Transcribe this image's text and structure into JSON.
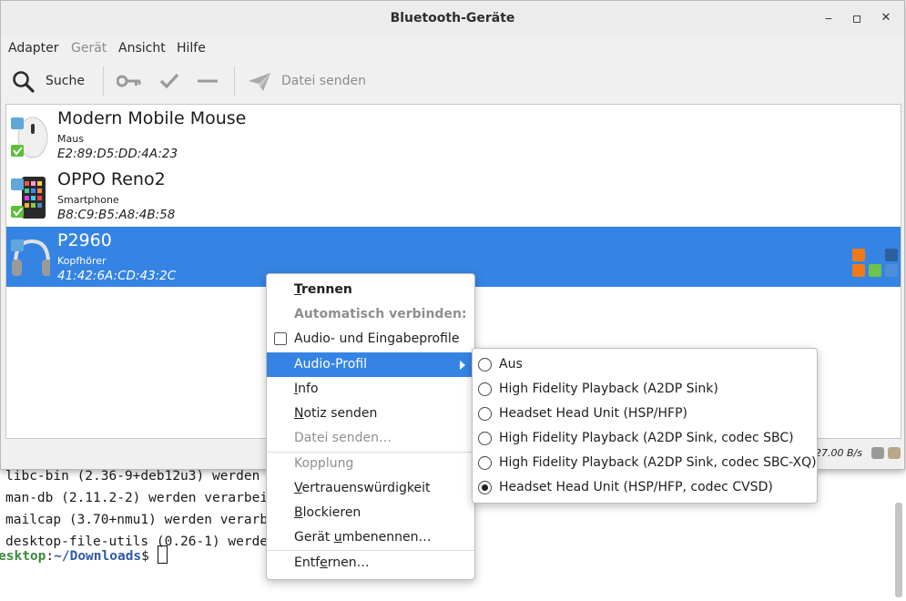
{
  "terminal": {
    "lines": [
      "libc-bin (2.36-9+deb12u3) werden verarbeitet ...",
      "man-db (2.11.2-2) werden verarbeitet ...",
      "mailcap (3.70+nmu1) werden verarbeitet ...",
      "desktop-file-utils (0.26-1) werden verarbeitet ..."
    ],
    "prompt_host": "esktop",
    "prompt_sep": ":",
    "prompt_path": "~/Downloads",
    "prompt_symbol": "$ "
  },
  "window": {
    "title": "Bluetooth-Geräte",
    "minimize": "_",
    "maximize": "▫",
    "close": "✕"
  },
  "menubar": {
    "adapter": "Adapter",
    "geraet": "Gerät",
    "ansicht": "Ansicht",
    "hilfe": "Hilfe"
  },
  "toolbar": {
    "search": "Suche",
    "send_file": "Datei senden"
  },
  "devices": [
    {
      "name": "Modern Mobile Mouse",
      "type": "Maus",
      "address": "E2:89:D5:DD:4A:23"
    },
    {
      "name": "OPPO Reno2",
      "type": "Smartphone",
      "address": "B8:C9:B5:A8:4B:58"
    },
    {
      "name": "P2960",
      "type": "Kopfhörer",
      "address": "41:42:6A:CD:43:2C"
    }
  ],
  "status": {
    "speed": "27.00 B/s"
  },
  "context_menu": {
    "disconnect_pre": "",
    "disconnect_ul": "T",
    "disconnect_post": "rennen",
    "auto_connect": "Automatisch verbinden:",
    "audio_input_profiles": "Audio- und Eingabeprofile",
    "audio_profile": "Audio-Profil",
    "info_pre": "",
    "info_ul": "I",
    "info_post": "nfo",
    "send_note_pre": "",
    "send_note_ul": "N",
    "send_note_post": "otiz senden",
    "send_file": "Datei senden…",
    "pairing": "Kopplung",
    "trust_pre": "",
    "trust_ul": "V",
    "trust_post": "ertrauenswürdigkeit",
    "block_pre": "",
    "block_ul": "B",
    "block_post": "lockieren",
    "rename_pre": "Gerät ",
    "rename_ul": "u",
    "rename_post": "mbenennen…",
    "remove_pre": "Entf",
    "remove_ul": "e",
    "remove_post": "rnen…"
  },
  "audio_profiles": [
    {
      "label": "Aus",
      "selected": false
    },
    {
      "label": "High Fidelity Playback (A2DP Sink)",
      "selected": false
    },
    {
      "label": "Headset Head Unit (HSP/HFP)",
      "selected": false
    },
    {
      "label": "High Fidelity Playback (A2DP Sink, codec SBC)",
      "selected": false
    },
    {
      "label": "High Fidelity Playback (A2DP Sink, codec SBC-XQ)",
      "selected": false
    },
    {
      "label": "Headset Head Unit (HSP/HFP, codec CVSD)",
      "selected": true
    }
  ]
}
